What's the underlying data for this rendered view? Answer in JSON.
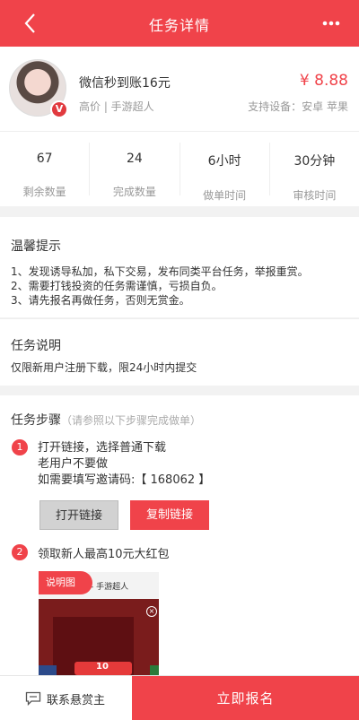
{
  "nav": {
    "title": "任务详情"
  },
  "task": {
    "name": "微信秒到账16元",
    "meta": "高价 | 手游超人",
    "price": "¥ 8.88",
    "devices": "支持设备：安卓 苹果",
    "avatar_badge": "V"
  },
  "stats": [
    {
      "value": "67",
      "label": "剩余数量"
    },
    {
      "value": "24",
      "label": "完成数量"
    },
    {
      "value": "6小时",
      "label": "做单时间"
    },
    {
      "value": "30分钟",
      "label": "审核时间"
    }
  ],
  "tips": {
    "title": "温馨提示",
    "lines": [
      "1、发现诱导私加，私下交易，发布同类平台任务，举报重赏。",
      "2、需要打钱投资的任务需谨慎，亏损自负。",
      "3、请先报名再做任务，否则无赏金。"
    ]
  },
  "description": {
    "title": "任务说明",
    "text": "仅限新用户注册下载，限24小时内提交"
  },
  "steps": {
    "title": "任务步骤",
    "subtitle": "（请参照以下步骤完成做单）",
    "step1": {
      "num": "1",
      "lines": [
        "打开链接，选择普通下载",
        "老用户不要做",
        "如需要填写邀请码:【 168062 】"
      ],
      "open_button": "打开链接",
      "copy_button": "复制链接"
    },
    "step2": {
      "num": "2",
      "text": "领取新人最高10元大红包",
      "image_tag": "说明图",
      "image_header": "- 手游超人",
      "image_amount": "10"
    }
  },
  "bottom": {
    "contact": "联系悬赏主",
    "signup": "立即报名"
  },
  "colors": {
    "accent": "#f0434a"
  }
}
